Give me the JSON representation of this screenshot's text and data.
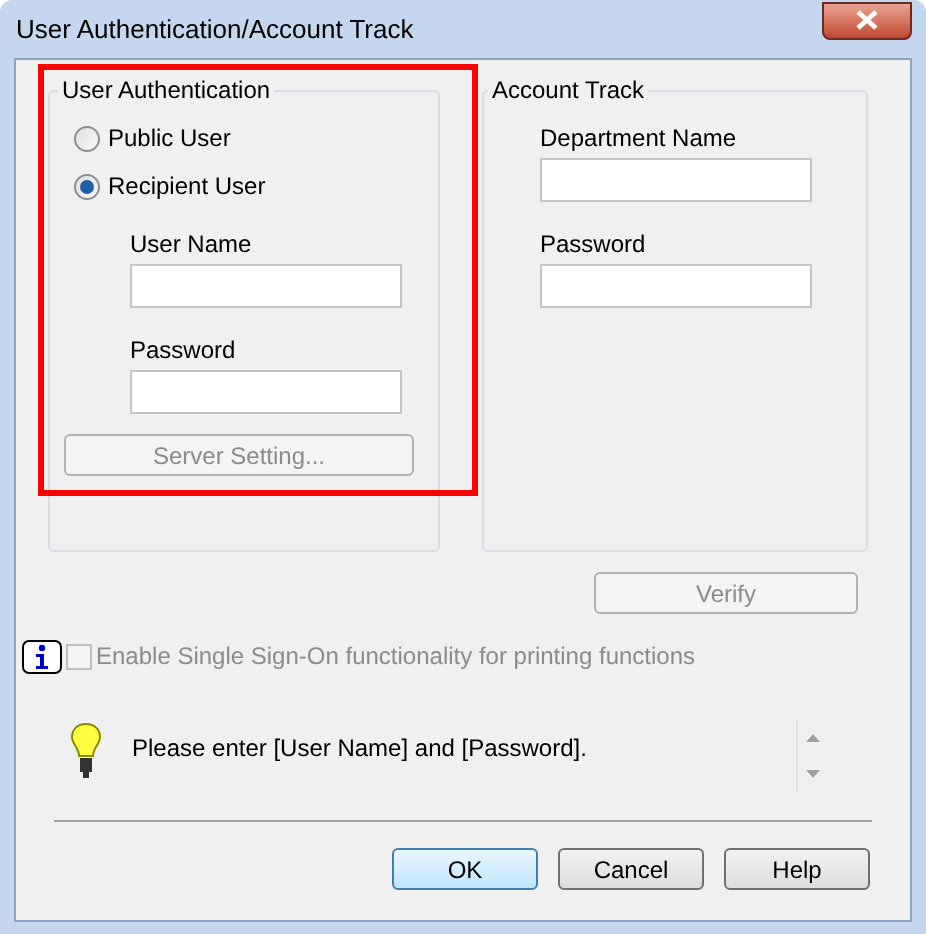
{
  "window": {
    "title": "User Authentication/Account Track"
  },
  "user_authentication": {
    "title": "User Authentication",
    "highlighted": true,
    "options": [
      {
        "label": "Public User",
        "selected": false
      },
      {
        "label": "Recipient User",
        "selected": true
      }
    ],
    "fields": [
      {
        "label": "User Name"
      },
      {
        "label": "Password"
      }
    ],
    "server_setting_button": {
      "label": "Server Setting...",
      "disabled": true
    }
  },
  "account_track": {
    "title": "Account Track",
    "fields": [
      {
        "label": "Department Name"
      },
      {
        "label": "Password"
      }
    ]
  },
  "verify_button": {
    "label": "Verify",
    "disabled": true
  },
  "single_sign_on": {
    "label": "Enable Single Sign-On functionality for printing functions",
    "checked": false,
    "disabled": true
  },
  "message": "Please enter [User Name] and [Password].",
  "buttons": [
    {
      "label": "OK",
      "default": true
    },
    {
      "label": "Cancel",
      "default": false
    },
    {
      "label": "Help",
      "default": false
    }
  ]
}
